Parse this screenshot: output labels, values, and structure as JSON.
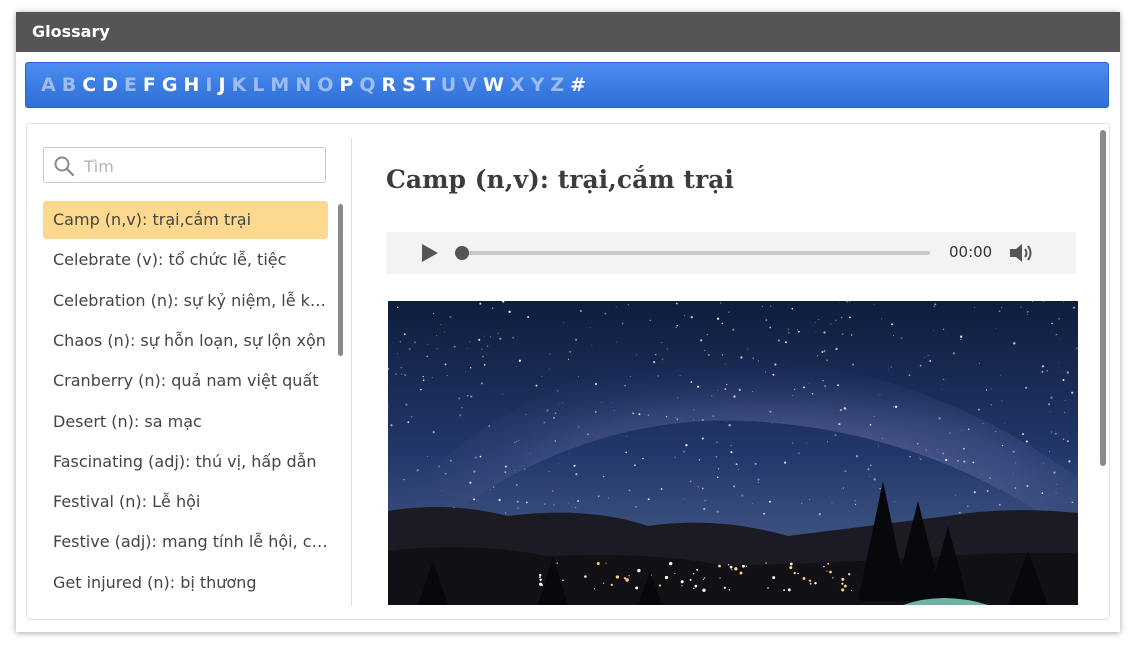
{
  "window": {
    "title": "Glossary"
  },
  "alphabet": [
    {
      "ch": "A",
      "on": false
    },
    {
      "ch": "B",
      "on": false
    },
    {
      "ch": "C",
      "on": true
    },
    {
      "ch": "D",
      "on": true
    },
    {
      "ch": "E",
      "on": false
    },
    {
      "ch": "F",
      "on": true
    },
    {
      "ch": "G",
      "on": true
    },
    {
      "ch": "H",
      "on": true
    },
    {
      "ch": "I",
      "on": false
    },
    {
      "ch": "J",
      "on": true
    },
    {
      "ch": "K",
      "on": false
    },
    {
      "ch": "L",
      "on": false
    },
    {
      "ch": "M",
      "on": false
    },
    {
      "ch": "N",
      "on": false
    },
    {
      "ch": "O",
      "on": false
    },
    {
      "ch": "P",
      "on": true
    },
    {
      "ch": "Q",
      "on": false
    },
    {
      "ch": "R",
      "on": true
    },
    {
      "ch": "S",
      "on": true
    },
    {
      "ch": "T",
      "on": true
    },
    {
      "ch": "U",
      "on": false
    },
    {
      "ch": "V",
      "on": false
    },
    {
      "ch": "W",
      "on": true
    },
    {
      "ch": "X",
      "on": false
    },
    {
      "ch": "Y",
      "on": false
    },
    {
      "ch": "Z",
      "on": false
    },
    {
      "ch": "#",
      "on": true
    }
  ],
  "search": {
    "placeholder": "Tìm",
    "value": ""
  },
  "entries": [
    "Camp (n,v): trại,cắm trại",
    "Celebrate (v): tổ chức lễ, tiệc",
    "Celebration (n): sự kỷ niệm, lễ kỷ ...",
    "Chaos (n): sự hỗn loạn, sự lộn xộn",
    "Cranberry (n): quả nam việt quất",
    "Desert (n): sa mạc",
    "Fascinating (adj): thú vị, hấp dẫn",
    "Festival (n): Lễ hội",
    "Festive (adj): mang tính lễ hội, có...",
    "Get injured (n): bị thương"
  ],
  "selected_index": 0,
  "detail": {
    "title": "Camp (n,v): trại,cắm trại",
    "audio": {
      "time": "00:00",
      "progress": 0
    }
  },
  "icons": {
    "search": "search-icon",
    "play": "play-icon",
    "volume": "volume-icon"
  },
  "colors": {
    "titlebar": "#555555",
    "alphabar": "#3a7ee6",
    "selected": "#fcd98f"
  }
}
